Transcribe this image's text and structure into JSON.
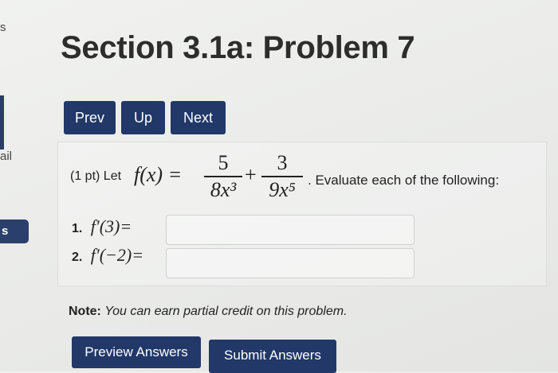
{
  "sidebar": {
    "top_letter": "s",
    "partial_text": "ail",
    "button_label": "s"
  },
  "header": {
    "title": "Section 3.1a: Problem 7"
  },
  "nav": {
    "prev": "Prev",
    "up": "Up",
    "next": "Next"
  },
  "problem": {
    "points": "(1 pt) Let",
    "function_lhs": "f(x) =",
    "term1": {
      "numerator": "5",
      "denominator": "8x³"
    },
    "operator": "+",
    "term2": {
      "numerator": "3",
      "denominator": "9x⁵"
    },
    "instruction": ". Evaluate each of the following:"
  },
  "items": [
    {
      "number": "1.",
      "expression": "f′(3)=",
      "value": ""
    },
    {
      "number": "2.",
      "expression": "f′(−2)=",
      "value": ""
    }
  ],
  "note": {
    "label": "Note:",
    "text": "You can earn partial credit on this problem."
  },
  "actions": {
    "preview": "Preview Answers",
    "submit": "Submit Answers"
  }
}
